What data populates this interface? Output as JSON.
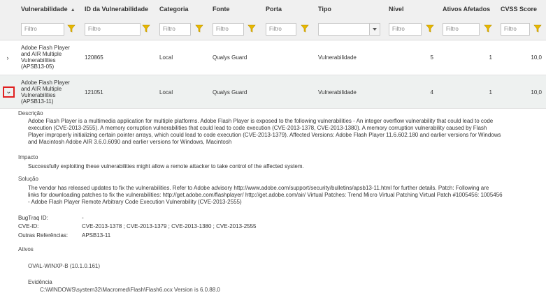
{
  "columns": {
    "vulnerabilidade": "Vulnerabilidade",
    "id": "ID da Vulnerabilidade",
    "categoria": "Categoria",
    "fonte": "Fonte",
    "porta": "Porta",
    "tipo": "Tipo",
    "nivel": "Nível",
    "ativos": "Ativos Afetados",
    "cvss": "CVSS Score"
  },
  "sort_indicator": "▲",
  "filter_placeholder": "Filtro",
  "rows": [
    {
      "expander": "›",
      "name_lines": [
        "Adobe Flash Player",
        "and AIR Multiple",
        "Vulnerabilities",
        "(APSB13-05)"
      ],
      "id": "120865",
      "categoria": "Local",
      "fonte": "Qualys Guard",
      "porta": "",
      "tipo": "Vulnerabilidade",
      "nivel": "5",
      "ativos": "1",
      "cvss": "10,0"
    },
    {
      "expander": "⌄",
      "name_lines": [
        "Adobe Flash Player",
        "and AIR Multiple",
        "Vulnerabilities",
        "(APSB13-11)"
      ],
      "id": "121051",
      "categoria": "Local",
      "fonte": "Qualys Guard",
      "porta": "",
      "tipo": "Vulnerabilidade",
      "nivel": "4",
      "ativos": "1",
      "cvss": "10,0"
    }
  ],
  "detail": {
    "descricao_title": "Descrição",
    "descricao_lines": [
      "Adobe Flash Player is a multimedia application for multiple platforms. Adobe Flash Player is exposed to the following vulnerabilities - An integer overflow vulnerability that could lead to code",
      "execution (CVE-2013-2555). A memory corruption vulnerabilities that could lead to code execution (CVE-2013-1378, CVE-2013-1380). A memory corruption vulnerability caused by Flash",
      "Player improperly initializing certain pointer arrays, which could lead to code execution (CVE-2013-1379). Affected Versions: Adobe Flash Player 11.6.602.180 and earlier versions for Windows",
      "and Macintosh Adobe AIR 3.6.0.6090 and earlier versions for Windows, Macintosh"
    ],
    "impacto_title": "Impacto",
    "impacto_text": "Successfully exploiting these vulnerabilities might allow a remote attacker to take control of the affected system.",
    "solucao_title": "Solução",
    "solucao_lines": [
      "The vendor has released updates to fix the vulnerabilities. Refer to Adobe advisory http://www.adobe.com/support/security/bulletins/apsb13-11.html for further details. Patch: Following are",
      "links for downloading patches to fix the vulnerabilities: http://get.adobe.com/flashplayer/ http://get.adobe.com/air/ Virtual Patches: Trend Micro Virtual Patching Virtual Patch #1005456: 1005456",
      "- Adobe Flash Player Remote Arbitrary Code Execution Vulnerability (CVE-2013-2555)"
    ],
    "bugtraq_label": "BugTraq ID:",
    "bugtraq_value": "-",
    "cve_label": "CVE-ID:",
    "cve_value": "CVE-2013-1378 ; CVE-2013-1379 ; CVE-2013-1380 ; CVE-2013-2555",
    "outras_label": "Outras Referências:",
    "outras_value": "APSB13-11",
    "ativos_title": "Ativos",
    "asset_name": "OVAL-WINXP-B (10.1.0.161)",
    "evidencia_title": "Evidência",
    "evidencia_text": "C:\\WINDOWS\\system32\\Macromed\\Flash\\Flash6.ocx Version is 6.0.88.0"
  },
  "colors": {
    "header_bg": "#f0f0f0",
    "selected_row_bg": "#eef1f0",
    "filter_icon": "#e8b800",
    "expander_highlight": "#e02020"
  },
  "icons": [
    "filter-icon",
    "chevron-right-icon",
    "chevron-down-icon",
    "dropdown-arrow-icon"
  ]
}
